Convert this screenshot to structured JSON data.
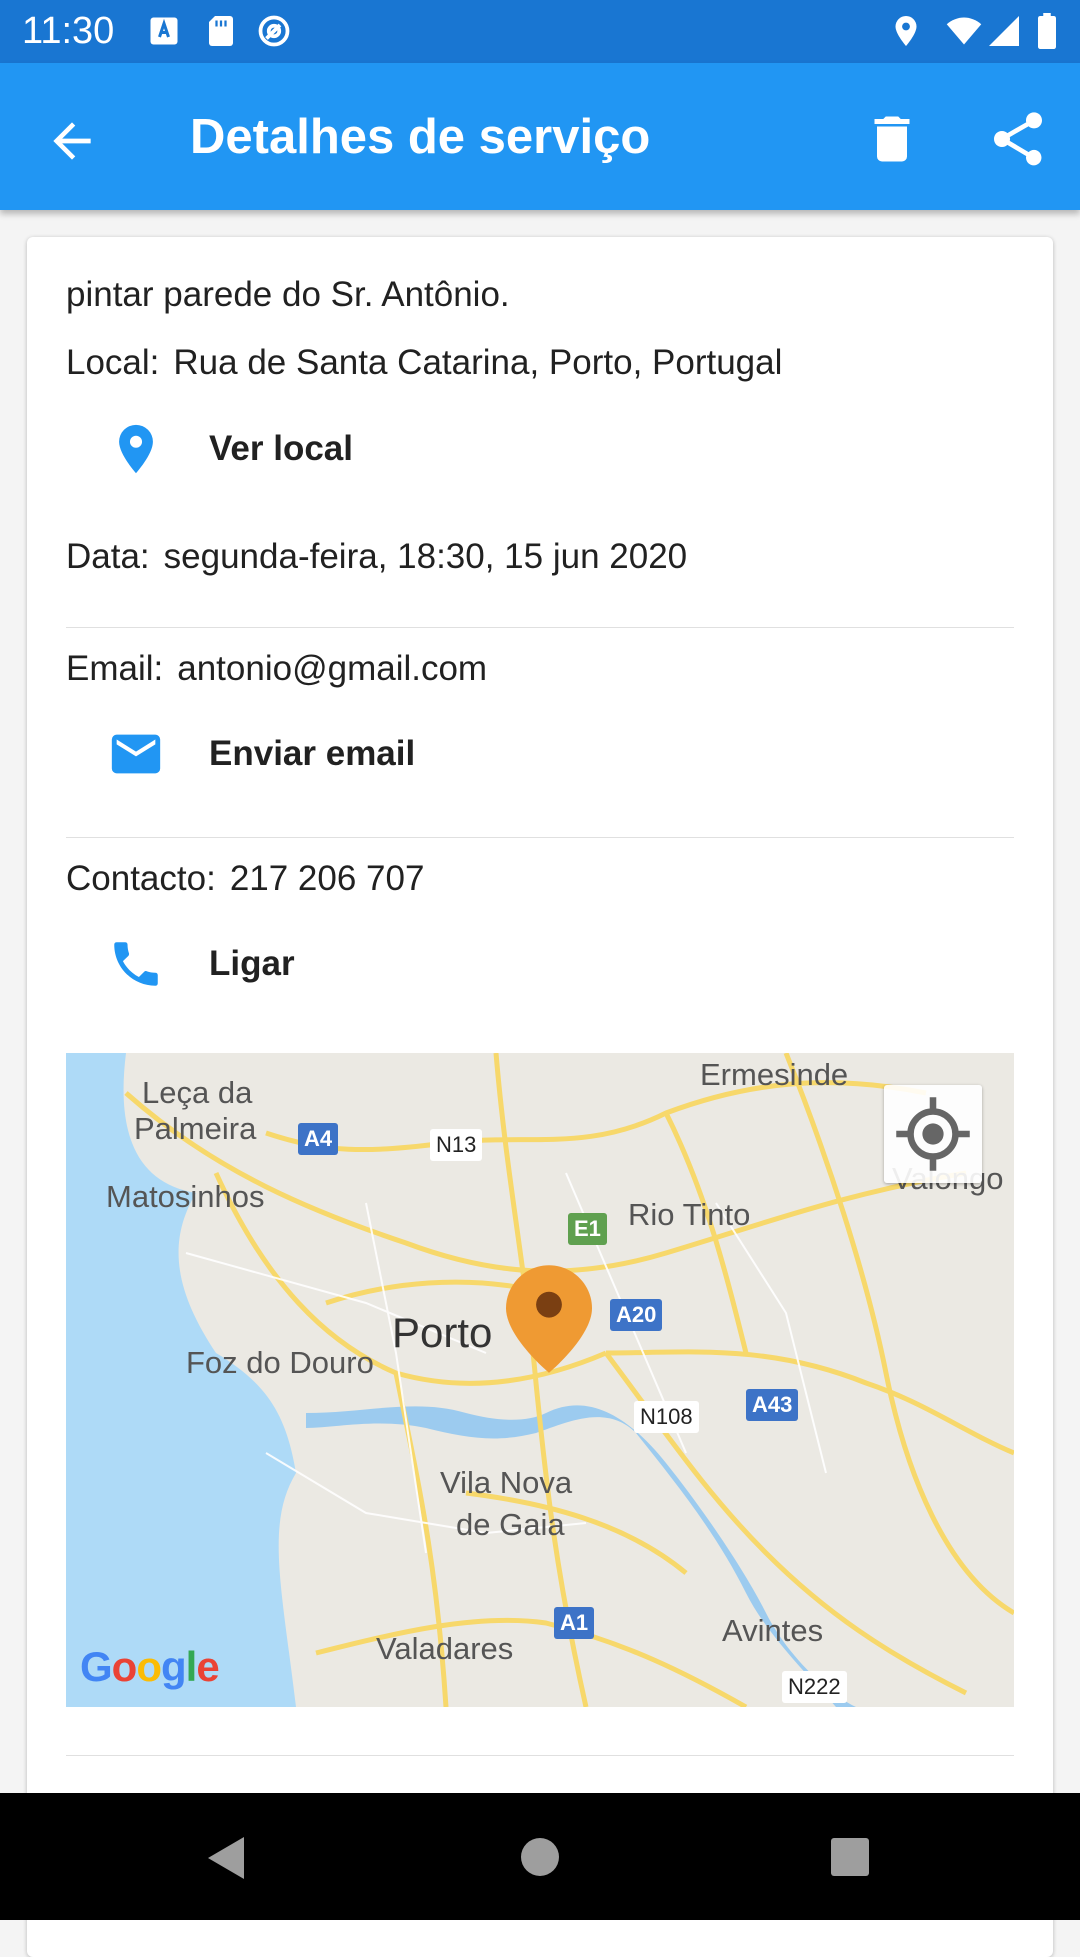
{
  "status_bar": {
    "time": "11:30",
    "left_icons": [
      "font-download-icon",
      "sd-card-icon",
      "at-sign-icon"
    ],
    "right_icons": [
      "location-icon",
      "wifi-icon",
      "signal-icon",
      "battery-icon"
    ]
  },
  "app_bar": {
    "title": "Detalhes de serviço",
    "back_icon": "arrow-back-icon",
    "delete_icon": "delete-icon",
    "share_icon": "share-icon"
  },
  "service": {
    "description": "pintar parede do Sr. Antônio.",
    "location_label": "Local:",
    "location_value": "Rua de Santa Catarina, Porto, Portugal",
    "view_location": "Ver local",
    "date_label": "Data:",
    "date_value": "segunda-feira, 18:30, 15 jun 2020",
    "email_label": "Email:",
    "email_value": "antonio@gmail.com",
    "send_email": "Enviar email",
    "contact_label": "Contacto:",
    "contact_value": "217 206 707",
    "call": "Ligar"
  },
  "map": {
    "places": [
      "Leça da",
      "Palmeira",
      "Matosinhos",
      "Ermesinde",
      "Valongo",
      "Rio Tinto",
      "Porto",
      "Foz do Douro",
      "Vila Nova",
      "de Gaia",
      "Valadares",
      "Avintes"
    ],
    "road_shields": [
      "A4",
      "E1",
      "A20",
      "A43",
      "A1"
    ],
    "road_labels": [
      "N13",
      "N108",
      "N222"
    ],
    "logo": "Google"
  },
  "nav_bar": {
    "icons": [
      "back-triangle-icon",
      "home-circle-icon",
      "recents-square-icon"
    ]
  },
  "colors": {
    "primary": "#2196f3",
    "primary_dark": "#1976d2",
    "accent_icon": "#2196f3",
    "marker": "#ef9a33"
  }
}
